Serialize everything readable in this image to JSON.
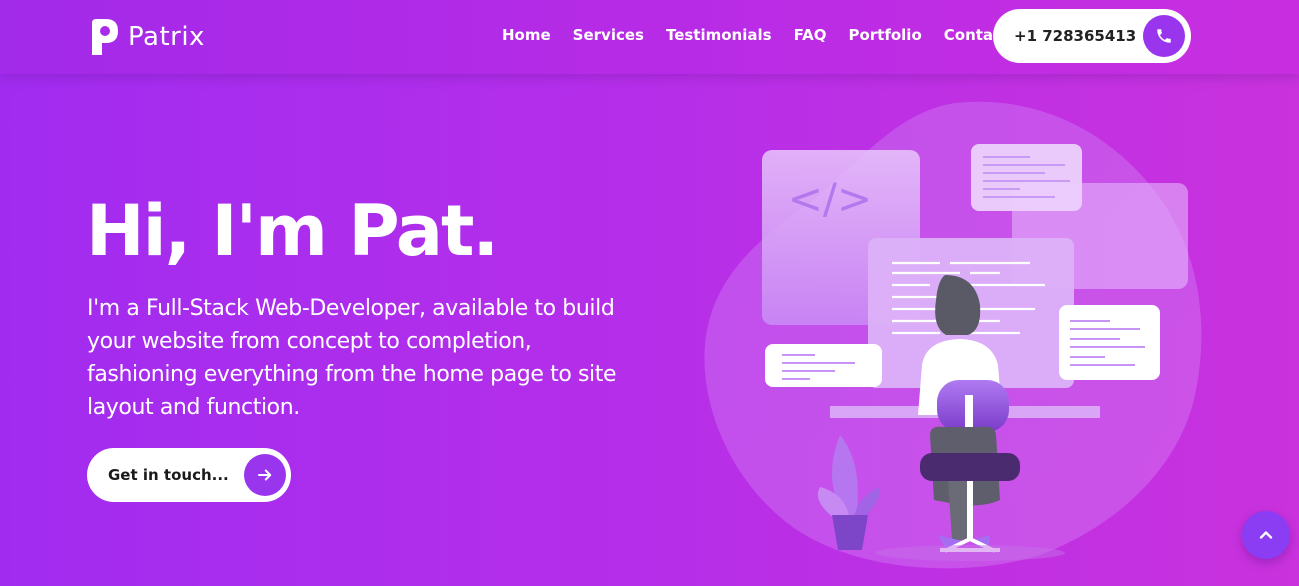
{
  "brand": {
    "name": "Patrix",
    "logo_icon": "letter-p-logo"
  },
  "nav": {
    "links": [
      "Home",
      "Services",
      "Testimonials",
      "FAQ",
      "Portfolio",
      "Contact"
    ],
    "phone": "+1 728365413",
    "phone_icon": "phone-icon"
  },
  "hero": {
    "title": "Hi, I'm Pat.",
    "description": "I'm a Full-Stack Web-Developer, available to build your website from concept to completion, fashioning everything from the home page to site layout and function.",
    "cta_label": "Get in touch...",
    "cta_icon": "arrow-right-icon",
    "illustration_code_tag": "</>"
  },
  "scroll_top_icon": "chevron-up-icon",
  "colors": {
    "accent": "#9a35ee",
    "gradient_start": "#a12cf0",
    "gradient_end": "#c932dd",
    "button_bg": "#ffffff"
  }
}
